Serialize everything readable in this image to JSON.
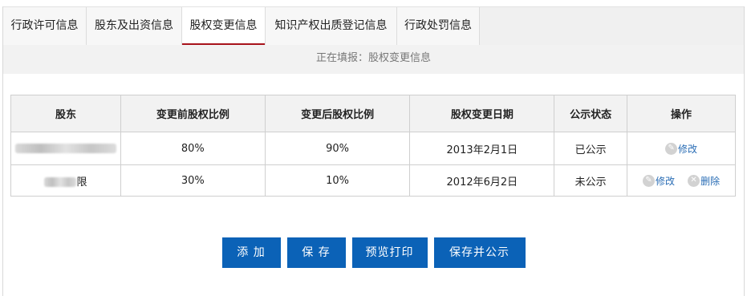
{
  "tabs": [
    {
      "label": "行政许可信息"
    },
    {
      "label": "股东及出资信息"
    },
    {
      "label": "股权变更信息"
    },
    {
      "label": "知识产权出质登记信息"
    },
    {
      "label": "行政处罚信息"
    }
  ],
  "status_text": "正在填报：股权变更信息",
  "table": {
    "headers": [
      "股东",
      "变更前股权比例",
      "变更后股权比例",
      "股权变更日期",
      "公示状态",
      "操作"
    ],
    "rows": [
      {
        "shareholder_tail": "",
        "before": "80%",
        "after": "90%",
        "date": "2013年2月1日",
        "status": "已公示",
        "edit": "修改"
      },
      {
        "shareholder_tail": "限",
        "before": "30%",
        "after": "10%",
        "date": "2012年6月2日",
        "status": "未公示",
        "edit": "修改",
        "delete": "删除"
      }
    ]
  },
  "buttons": {
    "add": "添 加",
    "save": "保 存",
    "preview_print": "预览打印",
    "save_publish": "保存并公示"
  },
  "colors": {
    "accent": "#a8131b",
    "button": "#0b62b7",
    "link": "#2a6db5"
  },
  "icons": {
    "edit": "pencil-icon",
    "delete": "close-circle-icon"
  }
}
